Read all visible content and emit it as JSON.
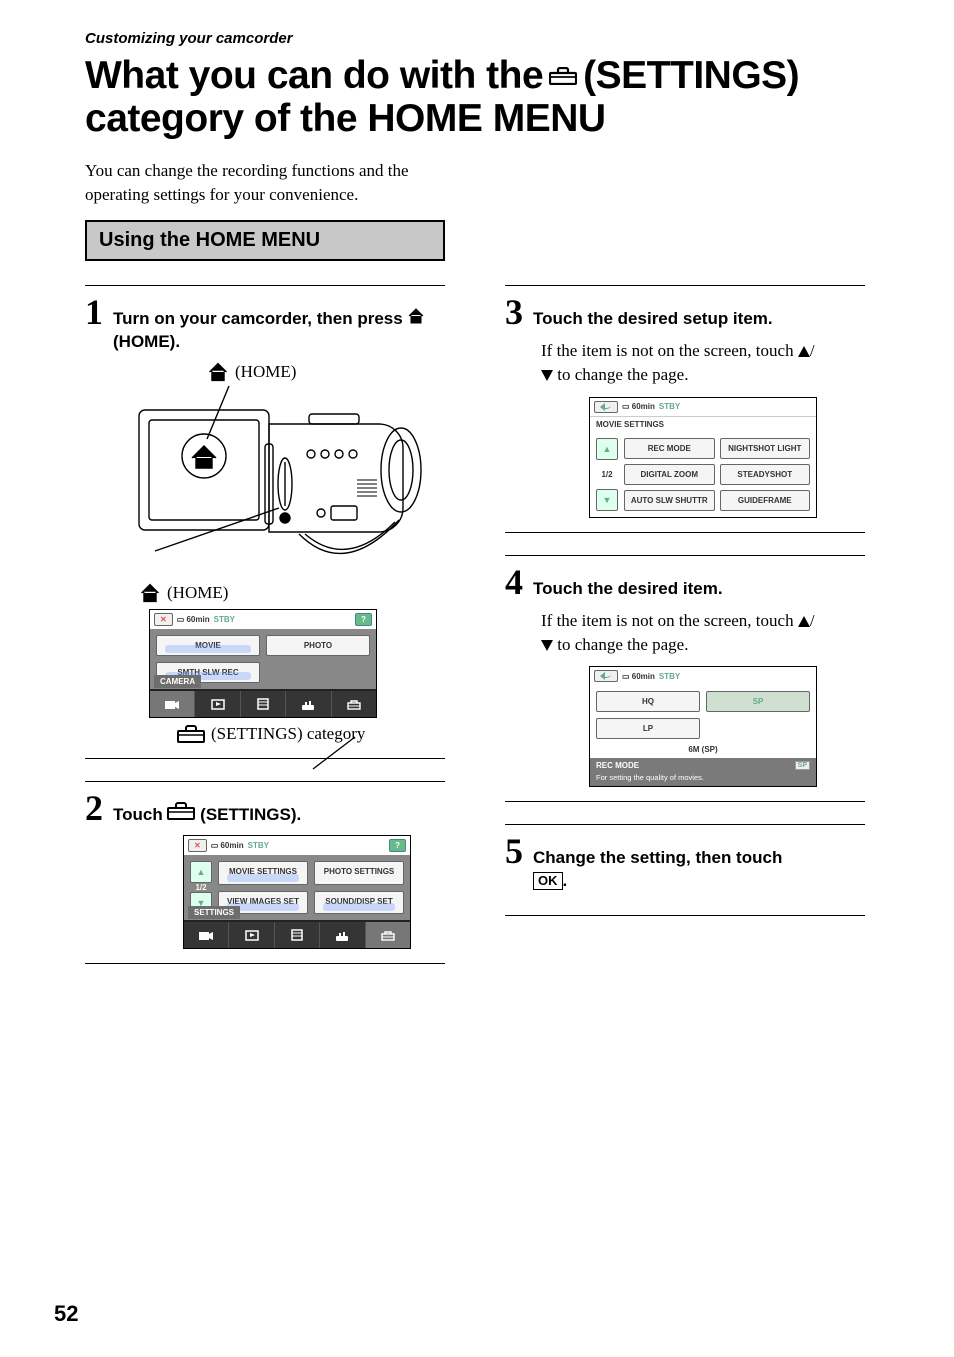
{
  "masthead": "Customizing your camcorder",
  "title_line1_pre": "What you can do with the ",
  "title_line1_post": "(SETTINGS)",
  "title_line2": "category of the HOME MENU",
  "intro": "You can change the recording functions and the operating settings for your convenience.",
  "section_head": "Using the HOME MENU",
  "steps": {
    "s1": {
      "num": "1",
      "text_a": "Turn on your camcorder, then press ",
      "text_b": " (HOME)."
    },
    "s2": {
      "num": "2",
      "text_a": "Touch ",
      "text_b": " (SETTINGS)."
    },
    "s3": {
      "num": "3",
      "text": "Touch the desired setup item.",
      "body_a": "If the item is not on the screen, touch ",
      "body_b": " to change the page."
    },
    "s4": {
      "num": "4",
      "text": "Touch the desired item.",
      "body_a": "If the item is not on the screen, touch ",
      "body_b": " to change the page."
    },
    "s5": {
      "num": "5",
      "text_a": "Change the setting, then touch ",
      "ok": "OK",
      "text_b": "."
    }
  },
  "captions": {
    "home_top": " (HOME)",
    "home_side": " (HOME)",
    "settings_cat": " (SETTINGS) category"
  },
  "lcd_common": {
    "batt": "60min",
    "status": "STBY"
  },
  "lcd1": {
    "btns": [
      "MOVIE",
      "PHOTO",
      "SMTH SLW REC"
    ],
    "footer": "CAMERA"
  },
  "lcd2": {
    "page": "1/2",
    "btns": [
      "MOVIE SETTINGS",
      "PHOTO SETTINGS",
      "VIEW IMAGES SET",
      "SOUND/DISP SET"
    ],
    "footer": "SETTINGS"
  },
  "lcd3": {
    "title": "MOVIE SETTINGS",
    "page": "1/2",
    "btns": [
      "REC MODE",
      "NIGHTSHOT LIGHT",
      "DIGITAL ZOOM",
      "STEADYSHOT",
      "AUTO SLW SHUTTR",
      "GUIDEFRAME"
    ]
  },
  "lcd4": {
    "btns": [
      "HQ",
      "SP",
      "LP"
    ],
    "note": "6M (SP)",
    "footer_title": "REC MODE",
    "footer_desc": "For setting the quality of movies.",
    "badge": "SP"
  },
  "page_number": "52"
}
